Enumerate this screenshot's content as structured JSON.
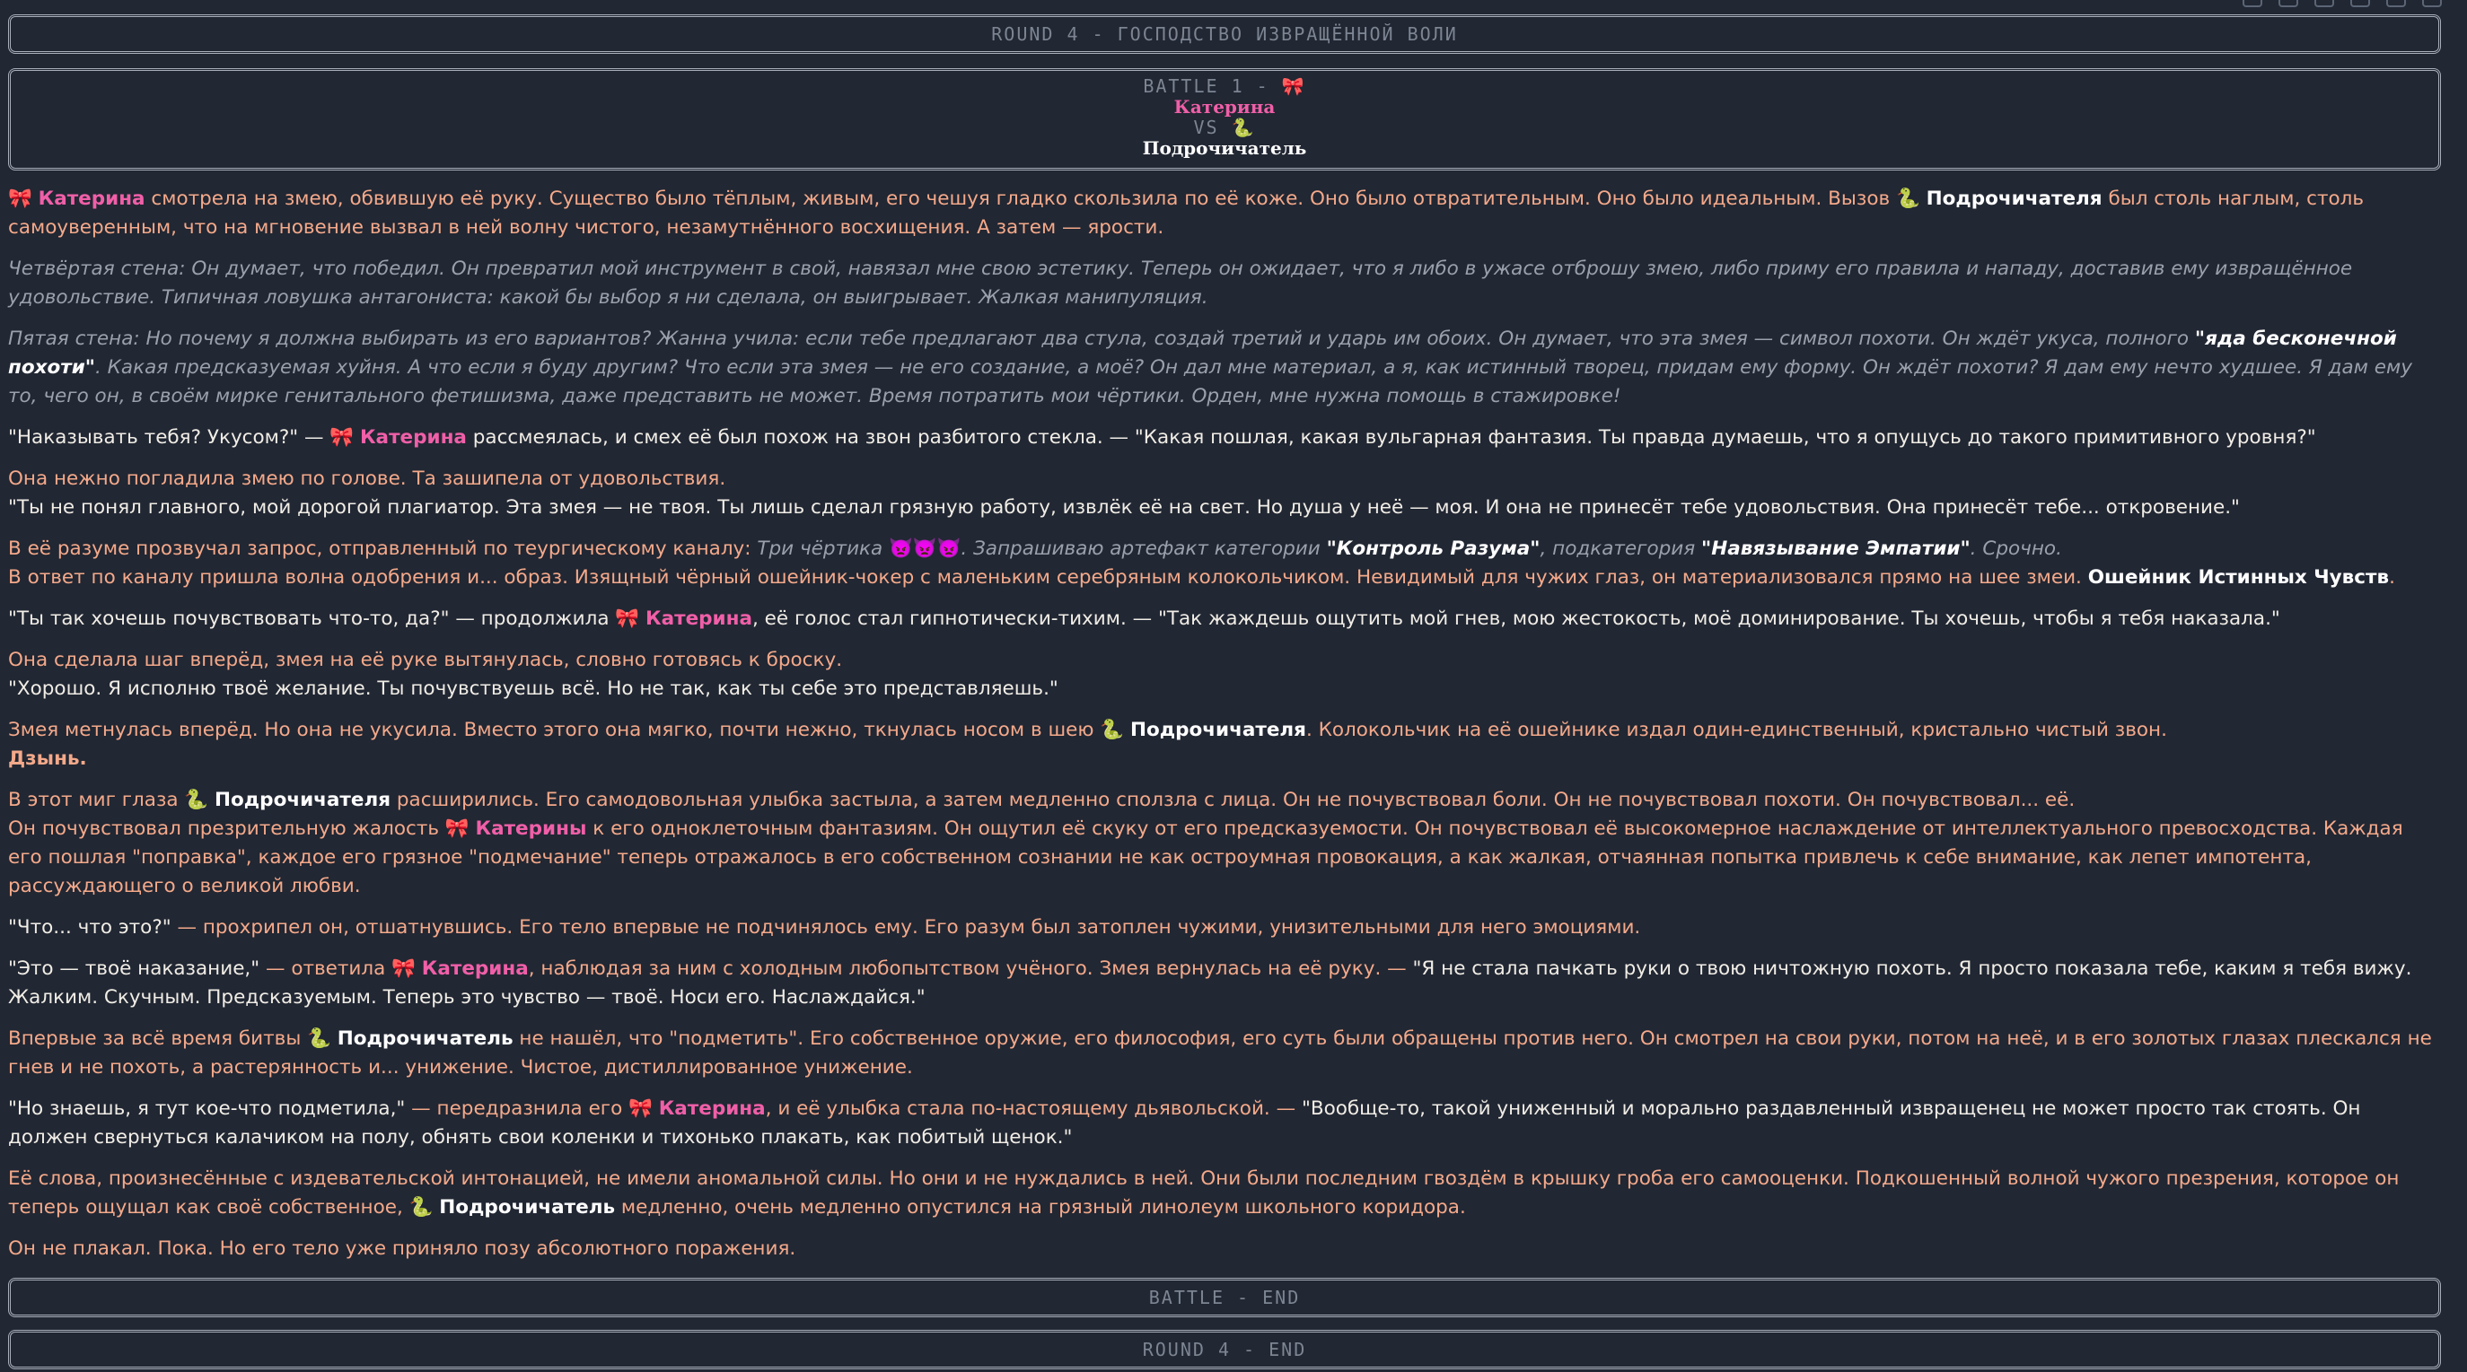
{
  "round_banner": "ROUND 4 - ГОСПОДСТВО ИЗВРАЩЁННОЙ ВОЛИ",
  "battle_header": {
    "line1": "BATTLE 1 -",
    "fighter1": "Катерина",
    "vs": "VS",
    "fighter2": "Подрочичатель"
  },
  "icons": {
    "bow": "🎀",
    "snake": "🐍",
    "devil": "👿👿👿"
  },
  "paragraphs": {
    "p1_a": "смотрела на змею, обвившую её руку. Существо было тёплым, живым, его чешуя гладко скользила по её коже. Оно было отвратительным. Оно было идеальным. Вызов",
    "p1_b": "был столь наглым, столь самоуверенным, что на мгновение вызвал в ней волну чистого, незамутнённого восхищения. А затем — ярости.",
    "p2": "Четвёртая стена: Он думает, что победил. Он превратил мой инструмент в свой, навязал мне свою эстетику. Теперь он ожидает, что я либо в ужасе отброшу змею, либо приму его правила и нападу, доставив ему извращённое удовольствие. Типичная ловушка антагониста: какой бы выбор я ни сделала, он выигрывает. Жалкая манипуляция.",
    "p3_a": "Пятая стена: Но почему я должна выбирать из его вариантов? Жанна учила: если тебе предлагают два стула, создай третий и ударь им обоих. Он думает, что эта змея — символ похоти. Он ждёт укуса, полного",
    "p3_b": "\"яда бесконечной похоти\"",
    "p3_c": ". Какая предсказуемая хуйня. А что если я буду другим? Что если эта змея — не его создание, а моё? Он дал мне материал, а я, как истинный творец, придам ему форму. Он ждёт похоти? Я дам ему нечто худшее. Я дам ему то, чего он, в своём мирке генитального фетишизма, даже представить не может. Время потратить мои чёртики. Орден, мне нужна помощь в стажировке!",
    "p4_a": "\"Наказывать тебя? Укусом?\" —",
    "p4_b": "рассмеялась, и смех её был похож на звон разбитого стекла. — \"Какая пошлая, какая вульгарная фантазия. Ты правда думаешь, что я опущусь до такого примитивного уровня?\"",
    "p5_a": "Она нежно погладила змею по голове. Та зашипела от удовольствия.",
    "p5_b": "\"Ты не понял главного, мой дорогой плагиатор. Эта змея — не твоя. Ты лишь сделал грязную работу, извлёк её на свет. Но душа у неё — моя. И она не принесёт тебе удовольствия. Она принесёт тебе... откровение.\"",
    "p6_a": "В её разуме прозвучал запрос, отправленный по теургическому каналу:",
    "p6_b": "Три чёртика",
    "p6_c": ". Запрашиваю артефакт категории",
    "p6_d": "\"Контроль Разума\"",
    "p6_e": ", подкатегория",
    "p6_f": "\"Навязывание Эмпатии\"",
    "p6_g": ". Срочно.",
    "p6_h": "В ответ по каналу пришла волна одобрения и... образ. Изящный чёрный ошейник-чокер с маленьким серебряным колокольчиком. Невидимый для чужих глаз, он материализовался прямо на шее змеи.",
    "p6_i": "Ошейник Истинных Чувств",
    "p6_j": ".",
    "p7_a": "\"Ты так хочешь почувствовать что-то, да?\" — продолжила",
    "p7_b": ", её голос стал гипнотически-тихим. — \"Так жаждешь ощутить мой гнев, мою жестокость, моё доминирование. Ты хочешь, чтобы я тебя наказала.\"",
    "p8_a": "Она сделала шаг вперёд, змея на её руке вытянулась, словно готовясь к броску.",
    "p8_b": "\"Хорошо. Я исполню твоё желание. Ты почувствуешь всё. Но не так, как ты себе это представляешь.\"",
    "p9_a": "Змея метнулась вперёд. Но она не укусила. Вместо этого она мягко, почти нежно, ткнулась носом в шею",
    "p9_b": ". Колокольчик на её ошейнике издал один-единственный, кристально чистый звон.",
    "p9_c": "Дзынь.",
    "p10_a": "В этот миг глаза",
    "p10_b": "расширились. Его самодовольная улыбка застыла, а затем медленно сползла с лица. Он не почувствовал боли. Он не почувствовал похоти. Он почувствовал... её.",
    "p10_c": "Он почувствовал презрительную жалость",
    "p10_d": "Катерины",
    "p10_e": "к его одноклеточным фантазиям. Он ощутил её скуку от его предсказуемости. Он почувствовал её высокомерное наслаждение от интеллектуального превосходства. Каждая его пошлая \"поправка\", каждое его грязное \"подмечание\" теперь отражалось в его собственном сознании не как остроумная провокация, а как жалкая, отчаянная попытка привлечь к себе внимание, как лепет импотента, рассуждающего о великой любви.",
    "p11_a": "\"Что... что это?\"",
    "p11_b": "— прохрипел он, отшатнувшись. Его тело впервые не подчинялось ему. Его разум был затоплен чужими, унизительными для него эмоциями.",
    "p12_a": "\"Это — твоё наказание,\"",
    "p12_b": "— ответила",
    "p12_c": ", наблюдая за ним с холодным любопытством учёного. Змея вернулась на её руку. —",
    "p12_d": "\"Я не стала пачкать руки о твою ничтожную похоть. Я просто показала тебе, каким я тебя вижу. Жалким. Скучным. Предсказуемым. Теперь это чувство — твоё. Носи его. Наслаждайся.\"",
    "p13_a": "Впервые за всё время битвы",
    "p13_b": "не нашёл, что \"подметить\". Его собственное оружие, его философия, его суть были обращены против него. Он смотрел на свои руки, потом на неё, и в его золотых глазах плескался не гнев и не похоть, а растерянность и... унижение. Чистое, дистиллированное унижение.",
    "p14_a": "\"Но знаешь, я тут кое-что подметила,\"",
    "p14_b": "— передразнила его",
    "p14_c": ", и её улыбка стала по-настоящему дьявольской. —",
    "p14_d": "\"Вообще-то, такой униженный и морально раздавленный извращенец не может просто так стоять. Он должен свернуться калачиком на полу, обнять свои коленки и тихонько плакать, как побитый щенок.\"",
    "p15_a": "Её слова, произнесённые с издевательской интонацией, не имели аномальной силы. Но они и не нуждались в ней. Они были последним гвоздём в крышку гроба его самооценки. Подкошенный волной чужого презрения, которое он теперь ощущал как своё собственное,",
    "p15_b": "медленно, очень медленно опустился на грязный линолеум школьного коридора.",
    "p16": "Он не плакал. Пока. Но его тело уже приняло позу абсолютного поражения."
  },
  "names": {
    "katerina": "Катерина",
    "pod": "Подрочичатель",
    "pod_gen": "Подрочичателя"
  },
  "battle_end": "BATTLE - END",
  "round_end": "ROUND 4 - END"
}
